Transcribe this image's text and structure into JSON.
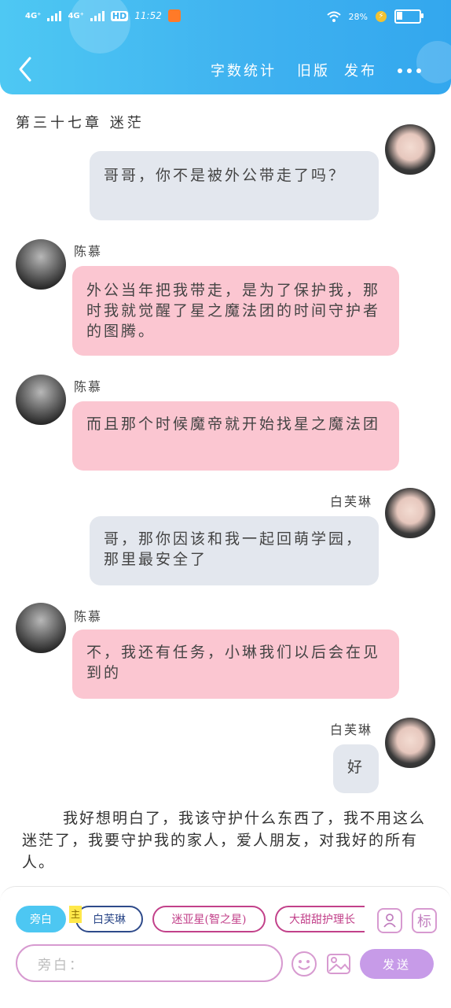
{
  "status_bar": {
    "signal1": "4G⁺",
    "signal2": "4G⁺",
    "hd": "HD",
    "time": "11:52",
    "battery": "28%"
  },
  "header": {
    "word_count": "字数统计",
    "old_version": "旧版",
    "publish": "发布"
  },
  "chapter_title": "第三十七章 迷茫",
  "messages": [
    {
      "speaker": "",
      "side": "right",
      "text": "哥哥，你不是被外公带走了吗？"
    },
    {
      "speaker": "陈慕",
      "side": "left",
      "text": "外公当年把我带走，是为了保护我，那时我就觉醒了星之魔法团的时间守护者的图腾。"
    },
    {
      "speaker": "陈慕",
      "side": "left",
      "text": "而且那个时候魔帝就开始找星之魔法团"
    },
    {
      "speaker": "白芙琳",
      "side": "right",
      "text": "哥，那你因该和我一起回萌学园，那里最安全了"
    },
    {
      "speaker": "陈慕",
      "side": "left",
      "text": "不，我还有任务，小琳我们以后会在见到的"
    },
    {
      "speaker": "白芙琳",
      "side": "right",
      "text": "好"
    }
  ],
  "narration": "我好想明白了，我该守护什么东西了，我不用这么迷茫了，我要守护我的家人，爱人朋友，对我好的所有人。",
  "composer": {
    "narrator_chip": "旁白",
    "main_tag": "主",
    "chips": [
      "白芙琳",
      "迷亚星(智之星)",
      "大甜甜护理长"
    ],
    "input_placeholder": "旁白：",
    "send": "发送",
    "icons": [
      "person-icon",
      "mark-icon",
      "emoji-icon",
      "picture-icon"
    ],
    "mark_label": "标"
  },
  "colors": {
    "header": "#3fb2f0",
    "pink_bubble": "#fbc6d1",
    "gray_bubble": "#e3e7ee",
    "send": "#c79be8"
  }
}
